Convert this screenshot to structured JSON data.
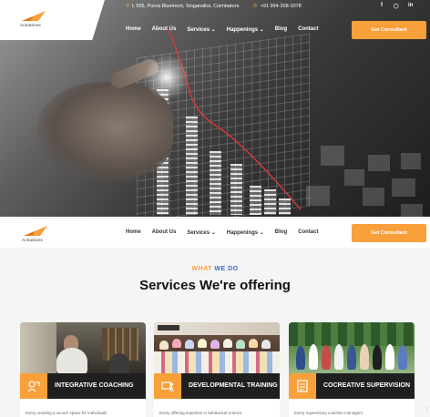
{
  "topbar": {
    "address": "L 505, Purva Bluemont, Singanallur, Coimbatore",
    "phone": "+91 994-208-1078",
    "social": [
      "f",
      "ig",
      "in"
    ]
  },
  "brand": {
    "name": "Actuations",
    "accent": "#f8a03a"
  },
  "nav": {
    "items": [
      "Home",
      "About Us",
      "Services",
      "Happenings",
      "Blog",
      "Contact"
    ],
    "active": "About Us",
    "cta": "Get Consultant"
  },
  "services": {
    "eyebrow_part1": "WHAT",
    "eyebrow_part2": "WE DO",
    "heading": "Services We're offering",
    "cards": [
      {
        "title": "INTEGRATIVE COACHING",
        "body": "Every creating a secure space for individuals"
      },
      {
        "title": "DEVELOPMENTAL TRAINING",
        "body": "Every offering expertise in behavioral science"
      },
      {
        "title": "COCREATIVE SUPERVISION",
        "body": "Every supervisory coaches managers"
      }
    ]
  }
}
